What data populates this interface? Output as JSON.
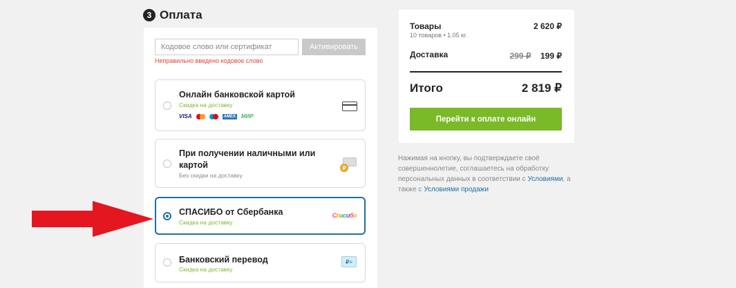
{
  "payment": {
    "step_number": "3",
    "title": "Оплата",
    "promo": {
      "placeholder": "Кодовое слово или сертификат",
      "button": "Активировать",
      "error": "Неправильно введено кодовое слово"
    },
    "options": [
      {
        "title": "Онлайн банковской картой",
        "subtitle": "Скидка на доставку",
        "selected": false,
        "icon": "credit-card-icon"
      },
      {
        "title_line1": "При получении наличными или",
        "title_line2": "картой",
        "subtitle": "Без скидки на доставку",
        "selected": false,
        "icon": "cash-coin-icon"
      },
      {
        "title": "СПАСИБО от Сбербанка",
        "subtitle": "Скидка на доставку",
        "selected": true,
        "icon": "spasibo-logo-icon"
      },
      {
        "title": "Банковский перевод",
        "subtitle": "Скидка на доставку",
        "selected": false,
        "icon": "bank-transfer-icon"
      }
    ],
    "brands": {
      "visa": "VISA",
      "amex": "AMEX",
      "mir": "МИР"
    },
    "spasibo_logo": "Спасибо",
    "coin_symbol": "₽",
    "bank_symbol": "₽≡"
  },
  "summary": {
    "goods_label": "Товары",
    "goods_value": "2 620 ₽",
    "goods_sub": "10 товаров • 1.05 кг.",
    "delivery_label": "Доставка",
    "delivery_old": "299 ₽",
    "delivery_value": "199 ₽",
    "total_label": "Итого",
    "total_value": "2 819 ₽",
    "pay_button": "Перейти к оплате онлайн"
  },
  "disclaimer": {
    "text1": "Нажимая на кнопку, вы подтверждаете своё совершеннолетие, соглашаетесь на обработку персональных данных в соответствии с ",
    "link1": "Условиями",
    "text2": ", а также с ",
    "link2": "Условиями продажи"
  },
  "colors": {
    "accent_green": "#7ab928",
    "selected_blue": "#1b6fa3",
    "error_red": "#e2412c",
    "arrow_red": "#e4161f"
  }
}
